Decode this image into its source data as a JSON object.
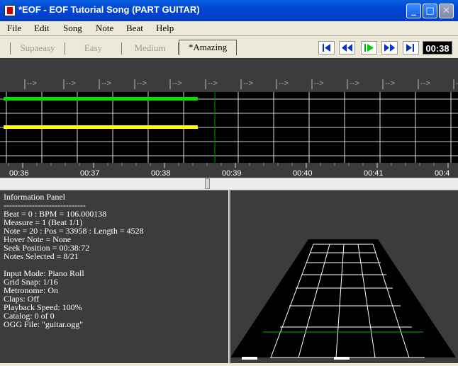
{
  "window": {
    "title": "*EOF - EOF Tutorial Song (PART GUITAR)",
    "minimize_label": "_",
    "maximize_label": "□",
    "close_label": "✕"
  },
  "menu": [
    "File",
    "Edit",
    "Song",
    "Note",
    "Beat",
    "Help"
  ],
  "difficulty_tabs": [
    "Supaeasy",
    "Easy",
    "Medium",
    "*Amazing"
  ],
  "active_tab": "*Amazing",
  "transport": {
    "buttons": [
      "skip-to-start",
      "rewind",
      "play",
      "fast-forward",
      "skip-to-end"
    ],
    "time": "00:38"
  },
  "editor": {
    "beat_marker": "-->",
    "timeline_labels": [
      "00:36",
      "00:37",
      "00:38",
      "00:39",
      "00:40",
      "00:41",
      "00:4"
    ],
    "lane_colors": {
      "green": "#00e000",
      "yellow": "#ffff00"
    },
    "playhead_color": "#00b000"
  },
  "info_panel": {
    "lines": [
      "Information Panel",
      "-----------------------------",
      "Beat = 0 : BPM = 106.000138",
      "Measure = 1 (Beat 1/1)",
      "Note = 20 : Pos = 33958 : Length = 4528",
      "Hover Note = None",
      "Seek Position = 00:38:72",
      "Notes Selected = 8/21",
      "",
      "Input Mode: Piano Roll",
      "Grid Snap: 1/16",
      "Metronome: On",
      "Claps: Off",
      "Playback Speed: 100%",
      "Catalog: 0 of 0",
      "OGG File: \"guitar.ogg\""
    ]
  }
}
